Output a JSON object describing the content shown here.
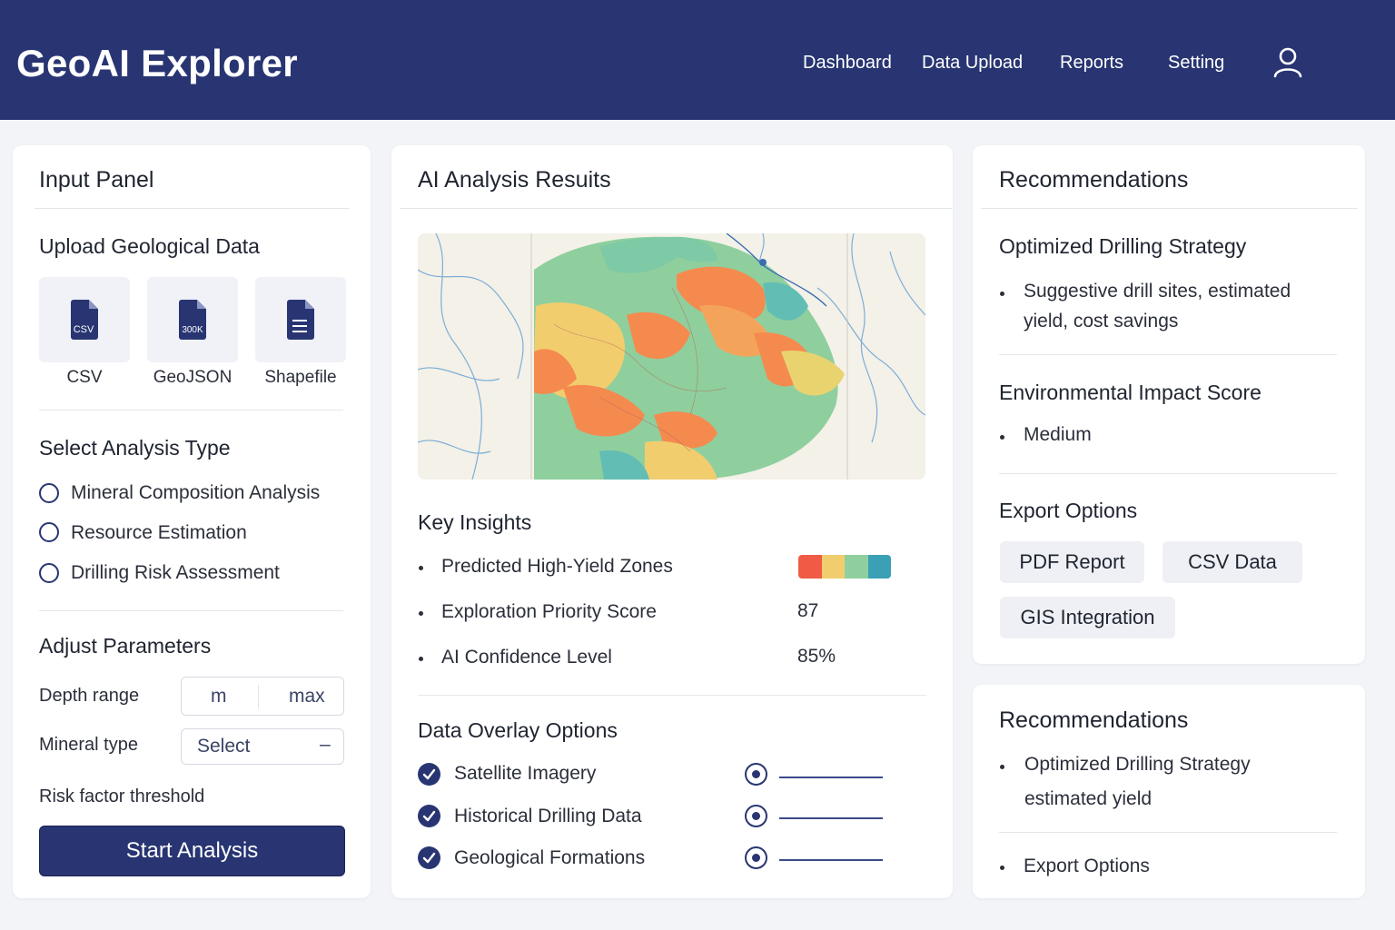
{
  "app": {
    "title": "GeoAI Explorer"
  },
  "nav": {
    "items": [
      "Dashboard",
      "Data Upload",
      "Reports",
      "Setting"
    ],
    "user_icon": "user-icon"
  },
  "input_panel": {
    "title": "Input Panel",
    "upload": {
      "title": "Upload Geological Data",
      "files": [
        {
          "badge": "CSV",
          "label": "CSV",
          "icon": "csv-file-icon"
        },
        {
          "badge": "300K",
          "label": "GeoJSON",
          "icon": "geojson-file-icon"
        },
        {
          "badge": "",
          "label": "Shapefile",
          "icon": "shapefile-file-icon"
        }
      ]
    },
    "analysis": {
      "title": "Select Analysis Type",
      "options": [
        "Mineral Composition Analysis",
        "Resource Estimation",
        "Drilling Risk Assessment"
      ]
    },
    "parameters": {
      "title": "Adjust Parameters",
      "depth_label": "Depth range",
      "depth_min": "m",
      "depth_max": "max",
      "mineral_label": "Mineral type",
      "mineral_value": "Select",
      "mineral_icon": "–",
      "risk_label": "Risk factor threshold"
    },
    "start_button": "Start Analysis"
  },
  "results": {
    "title": "AI Analysis Resuits",
    "map_icon": "heatmap-map",
    "insights": {
      "title": "Key Insights",
      "items": [
        {
          "label": "Predicted High-Yield Zones",
          "value": ""
        },
        {
          "label": "Exploration Priority Score",
          "value": "87"
        },
        {
          "label": "AI Confidence Level",
          "value": "85%"
        }
      ],
      "scale_colors": [
        "#ef5b45",
        "#f2cd6e",
        "#8fcf9e",
        "#3aa0b5"
      ]
    },
    "overlay": {
      "title": "Data Overlay Options",
      "options": [
        "Satellite Imagery",
        "Historical Drilling Data",
        "Geological Formations"
      ]
    }
  },
  "recommendations": {
    "title": "Recommendations",
    "strategy_title": "Optimized Drilling Strategy",
    "strategy_line1": "Suggestive drill sites, estimated",
    "strategy_line2": "yield, cost savings",
    "env_title": "Environmental Impact Score",
    "env_value": "Medium",
    "export_title": "Export Options",
    "export_buttons": [
      "PDF Report",
      "CSV Data",
      "GIS Integration"
    ]
  },
  "recommendations2": {
    "title": "Recommendations",
    "item1_line1": "Optimized Drilling Strategy",
    "item1_line2": "estimated yield",
    "item2": "Export Options"
  },
  "colors": {
    "primary": "#283572",
    "background": "#f3f4f8"
  }
}
